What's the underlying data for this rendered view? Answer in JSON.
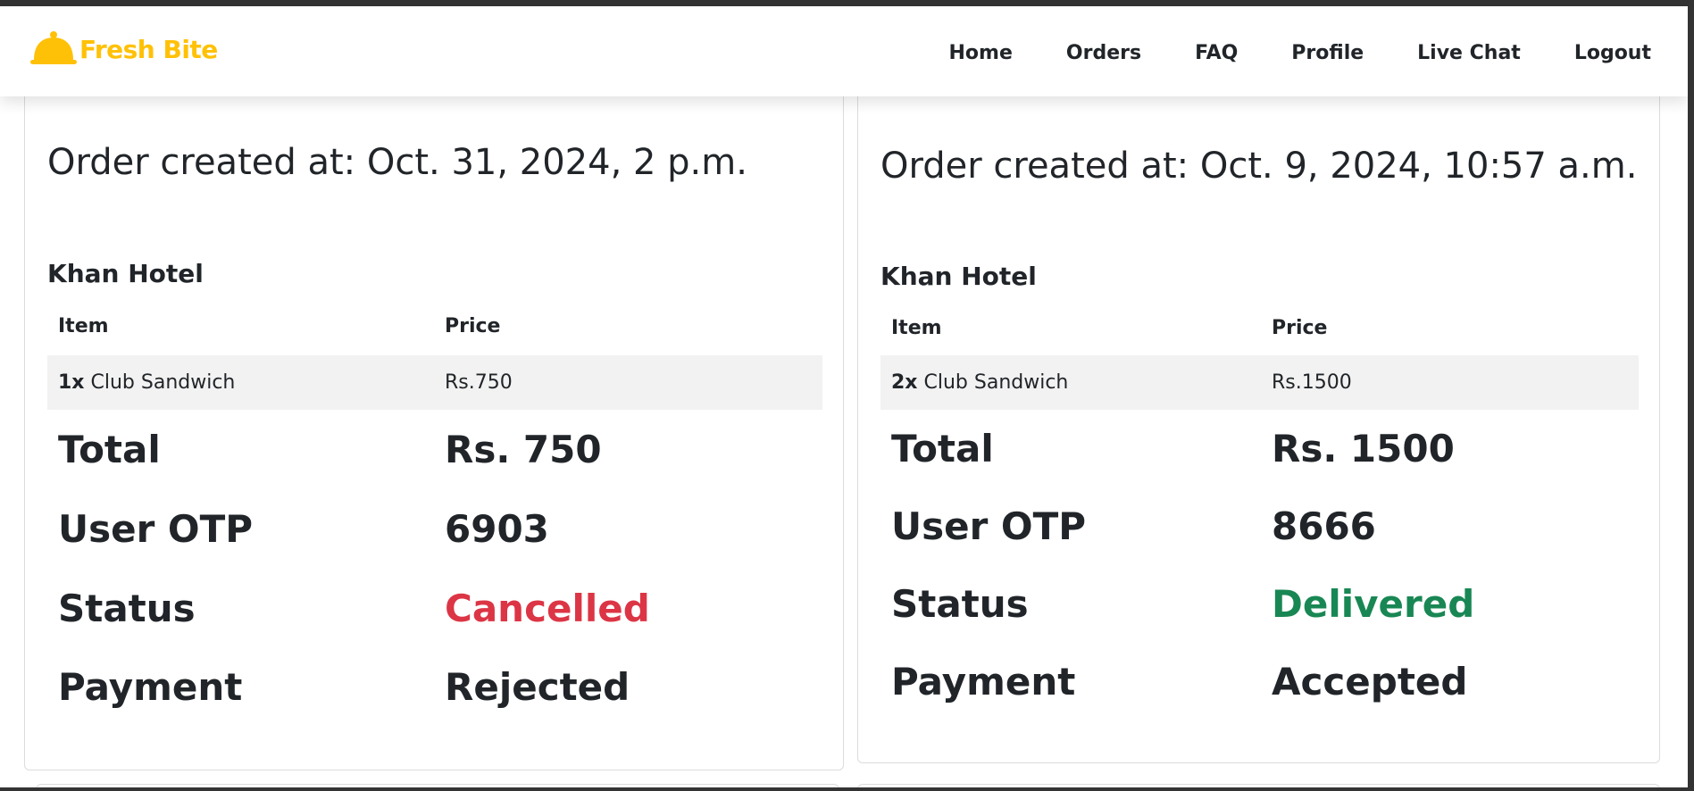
{
  "brand": {
    "name": "Fresh Bite",
    "icon": "cloche-icon",
    "color": "#ffc107"
  },
  "nav": {
    "links": [
      "Home",
      "Orders",
      "FAQ",
      "Profile",
      "Live Chat",
      "Logout"
    ]
  },
  "columns": {
    "item": "Item",
    "price": "Price"
  },
  "labels": {
    "total": "Total",
    "otp": "User OTP",
    "status": "Status",
    "payment": "Payment"
  },
  "orders": [
    {
      "created": "Order created at: Oct. 31, 2024, 2 p.m.",
      "hotel": "Khan Hotel",
      "items": [
        {
          "qty": "1x",
          "name": "Club Sandwich",
          "price": "Rs.750"
        }
      ],
      "total": "Rs. 750",
      "otp": "6903",
      "status": "Cancelled",
      "status_color": "#dc3545",
      "payment": "Rejected"
    },
    {
      "created": "Order created at: Oct. 9, 2024, 10:57 a.m.",
      "hotel": "Khan Hotel",
      "items": [
        {
          "qty": "2x",
          "name": "Club Sandwich",
          "price": "Rs.1500"
        }
      ],
      "total": "Rs. 1500",
      "otp": "8666",
      "status": "Delivered",
      "status_color": "#198754",
      "payment": "Accepted"
    }
  ]
}
